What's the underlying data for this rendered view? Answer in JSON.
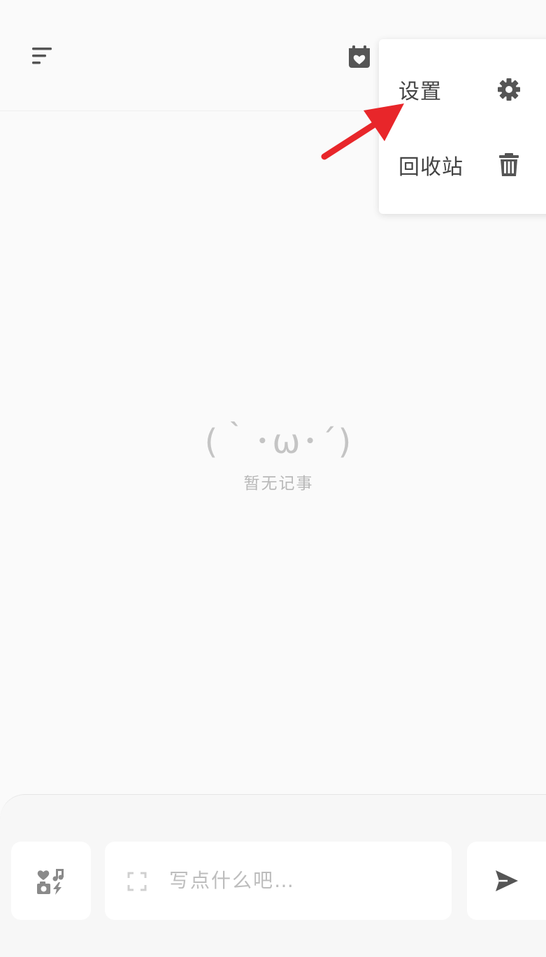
{
  "header": {
    "menu_icon": "sort-lines-icon",
    "calendar_icon": "calendar-heart-icon"
  },
  "menu": {
    "items": [
      {
        "label": "设置",
        "icon": "gear-icon"
      },
      {
        "label": "回收站",
        "icon": "trash-icon"
      }
    ]
  },
  "empty_state": {
    "emoticon": "(｀･ω･´)",
    "message": "暂无记事"
  },
  "composer": {
    "media_icon": "media-mix-icon",
    "expand_icon": "expand-icon",
    "placeholder": "写点什么吧…",
    "send_icon": "send-icon"
  },
  "colors": {
    "background": "#fafafa",
    "popup": "#ffffff",
    "icon": "#555555",
    "annotation": "#e8262a"
  }
}
